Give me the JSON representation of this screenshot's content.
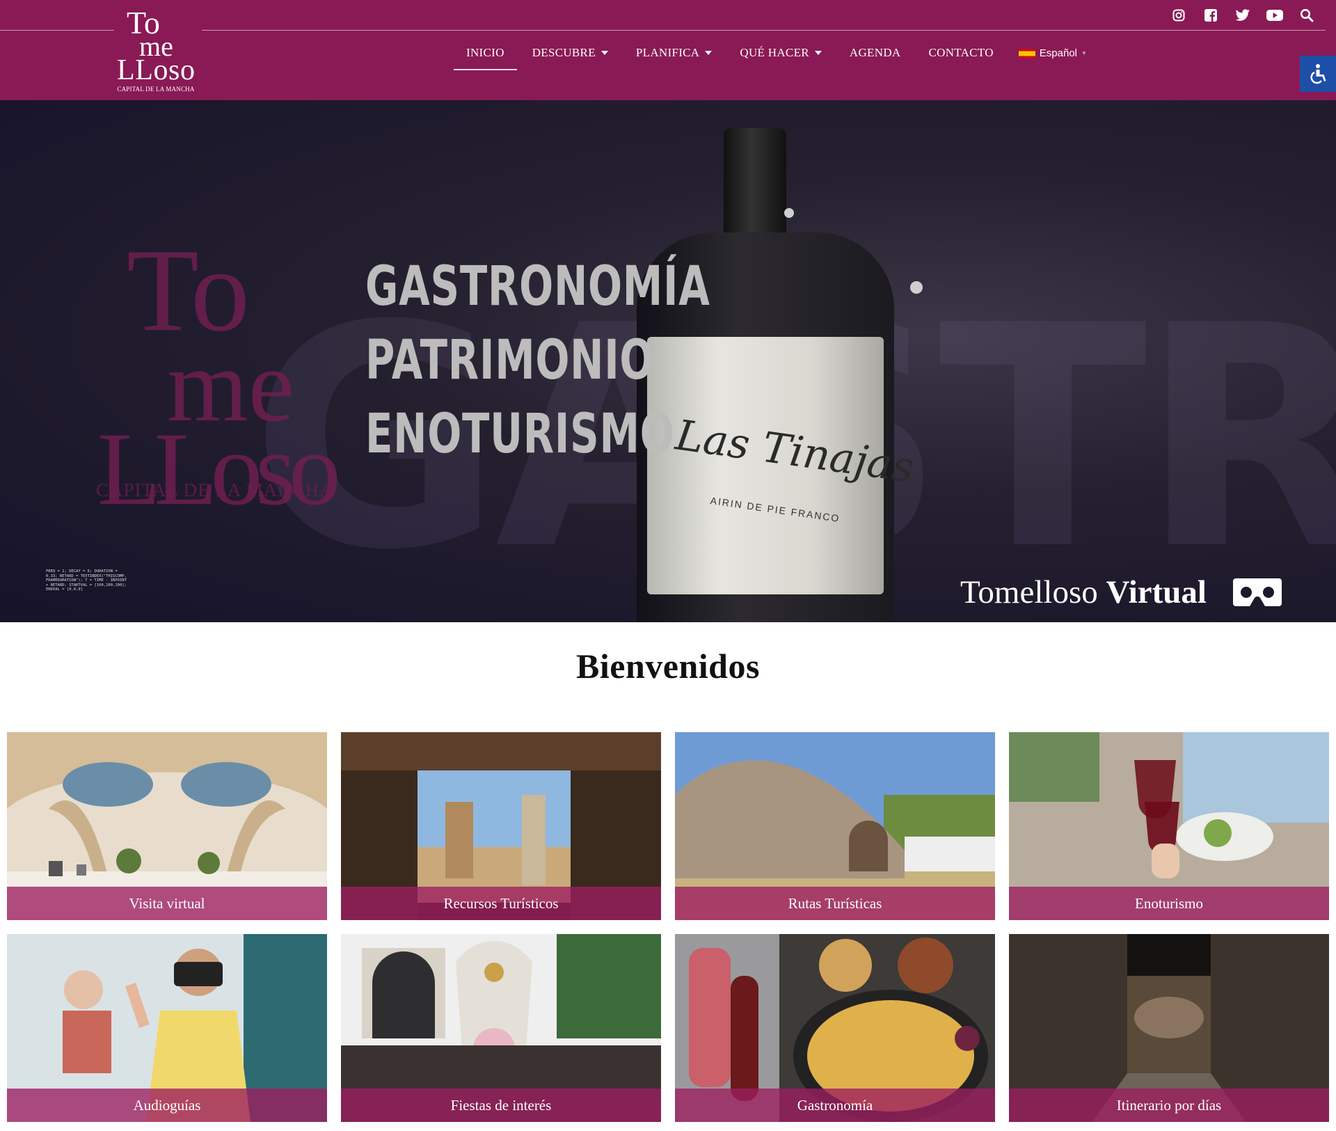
{
  "header": {
    "logo": {
      "word_top": "To",
      "word_mid": "me",
      "word_bottom": "LLoso",
      "tagline": "CAPITAL DE LA MANCHA"
    },
    "nav": [
      {
        "label": "INICIO",
        "dropdown": false,
        "active": true
      },
      {
        "label": "DESCUBRE",
        "dropdown": true
      },
      {
        "label": "PLANIFICA",
        "dropdown": true
      },
      {
        "label": "QUÉ HACER",
        "dropdown": true
      },
      {
        "label": "AGENDA",
        "dropdown": false
      },
      {
        "label": "CONTACTO",
        "dropdown": false
      }
    ],
    "language": "Español",
    "social_icons": [
      "instagram-icon",
      "facebook-icon",
      "twitter-icon",
      "youtube-icon",
      "search-icon"
    ],
    "accessibility_icon": "accessibility-icon"
  },
  "hero": {
    "lines": [
      "GASTRONOMÍA",
      "PATRIMONIO",
      "ENOTURISMO"
    ],
    "logo_tagline": "CAPITAL DE LA MANCHA",
    "bottle_label": "Las Tinajas",
    "bottle_sub": "AIRIN DE PIE FRANCO",
    "background_word": "GASTRON",
    "code_text": "FREQ = 1; DECAY = 6; DURATION = 0.33; RETARD = TEXTINDEX(\"THISCOMP. FRAMEDURATION\"); T = TIME - INPOINT + RETARD; STARTVAL = [100,100,100]; ENDVAL = [0,0,0]",
    "virtual": {
      "prefix": "Tomelloso",
      "emphasis": "Virtual"
    }
  },
  "main": {
    "title": "Bienvenidos",
    "tiles": [
      {
        "label": "Visita virtual"
      },
      {
        "label": "Recursos Turísticos"
      },
      {
        "label": "Rutas Turísticas"
      },
      {
        "label": "Enoturismo"
      },
      {
        "label": "Audioguías"
      },
      {
        "label": "Fiestas de interés"
      },
      {
        "label": "Gastronomía"
      },
      {
        "label": "Itinerario por días"
      }
    ]
  },
  "colors": {
    "brand": "#8a1a55",
    "caption": "#9c1e60",
    "accessibility": "#1e4fa8",
    "hero_text": "#bcbcbc"
  }
}
